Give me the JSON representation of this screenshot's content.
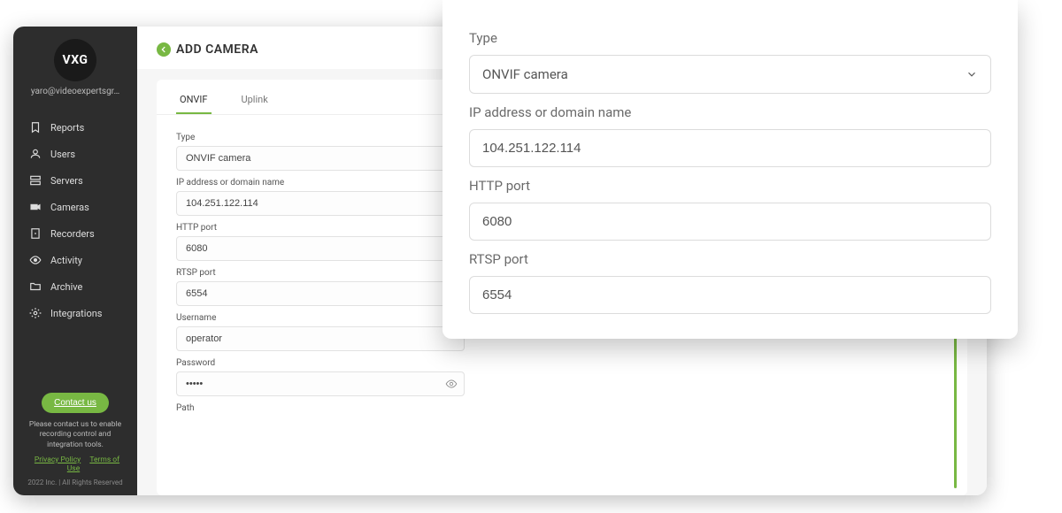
{
  "app": {
    "logo_text": "VXG",
    "user_email": "yaro@videoexpertsgr…"
  },
  "sidebar": {
    "items": [
      {
        "label": "Reports"
      },
      {
        "label": "Users"
      },
      {
        "label": "Servers"
      },
      {
        "label": "Cameras"
      },
      {
        "label": "Recorders"
      },
      {
        "label": "Activity"
      },
      {
        "label": "Archive"
      },
      {
        "label": "Integrations"
      }
    ],
    "contact_label": "Contact us",
    "footer_text": "Please contact us to enable recording control and integration tools.",
    "privacy_label": "Privacy Policy",
    "terms_label": "Terms of Use",
    "copyright": "2022 Inc. | All Rights Reserved"
  },
  "header": {
    "title": "ADD CAMERA"
  },
  "tabs": {
    "onvif": "ONVIF",
    "uplink": "Uplink"
  },
  "form": {
    "type_label": "Type",
    "type_value": "ONVIF camera",
    "ip_label": "IP address or domain name",
    "ip_value": "104.251.122.114",
    "http_label": "HTTP port",
    "http_value": "6080",
    "rtsp_label": "RTSP port",
    "rtsp_value": "6554",
    "username_label": "Username",
    "username_value": "operator",
    "password_label": "Password",
    "password_value": "•••••",
    "path_label": "Path"
  },
  "popup": {
    "type_label": "Type",
    "type_value": "ONVIF camera",
    "ip_label": "IP address or domain name",
    "ip_value": "104.251.122.114",
    "http_label": "HTTP port",
    "http_value": "6080",
    "rtsp_label": "RTSP port",
    "rtsp_value": "6554"
  }
}
